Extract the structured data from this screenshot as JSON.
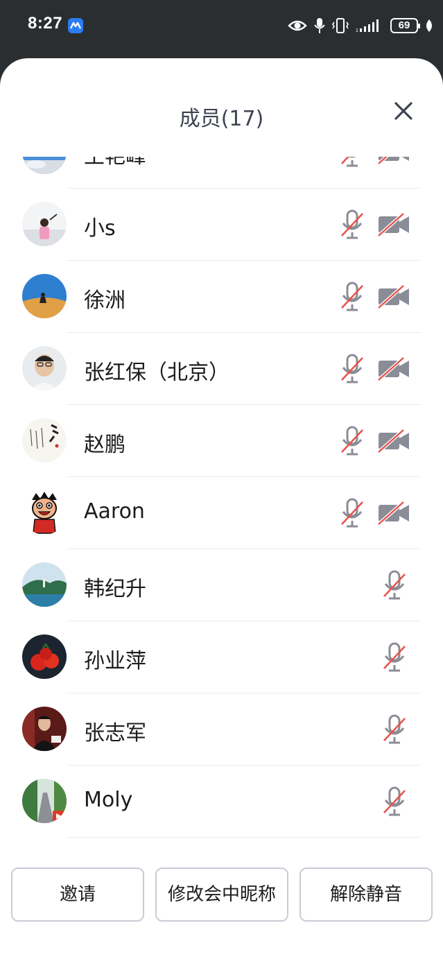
{
  "status_bar": {
    "time": "8:27",
    "battery": "69",
    "icons": [
      "eye-icon",
      "microphone-icon",
      "vibrate-icon",
      "signal-icon",
      "battery-icon",
      "leaf-icon"
    ]
  },
  "panel": {
    "title": "成员(17)",
    "close_icon": "close-icon"
  },
  "members": [
    {
      "name": "王艳峰",
      "mic_muted": true,
      "camera_off": true
    },
    {
      "name": "小s",
      "mic_muted": true,
      "camera_off": true
    },
    {
      "name": "徐洲",
      "mic_muted": true,
      "camera_off": true
    },
    {
      "name": "张红保（北京）",
      "mic_muted": true,
      "camera_off": true
    },
    {
      "name": "赵鹏",
      "mic_muted": true,
      "camera_off": true
    },
    {
      "name": "Aaron",
      "mic_muted": true,
      "camera_off": true
    },
    {
      "name": "韩纪升",
      "mic_muted": true,
      "camera_off": false
    },
    {
      "name": "孙业萍",
      "mic_muted": true,
      "camera_off": false
    },
    {
      "name": "张志军",
      "mic_muted": true,
      "camera_off": false
    },
    {
      "name": "Moly",
      "mic_muted": true,
      "camera_off": false
    }
  ],
  "actions": {
    "invite": "邀请",
    "rename": "修改会中昵称",
    "unmute": "解除静音"
  },
  "colors": {
    "mute_slash": "#e8544d",
    "icon_gray": "#8a8d96",
    "status_bar_bg": "#2b2e31"
  }
}
